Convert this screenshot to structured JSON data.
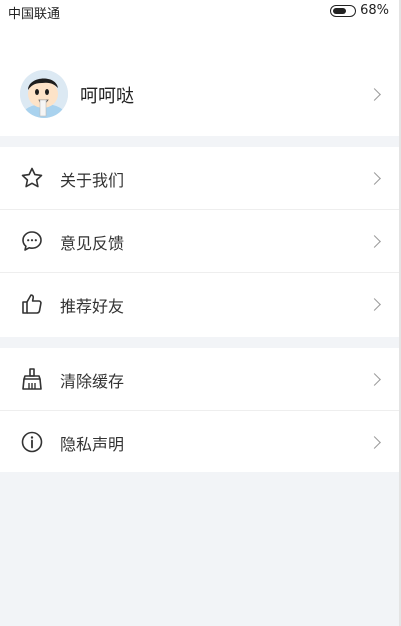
{
  "status_bar": {
    "carrier": "中国联通",
    "battery_percent_text": "68%",
    "battery_level": 0.68
  },
  "profile": {
    "name": "呵呵哒",
    "avatar_icon": "cartoon-avatar"
  },
  "menu_group_1": [
    {
      "label": "关于我们",
      "icon": "star-outline-icon"
    },
    {
      "label": "意见反馈",
      "icon": "chat-bubble-icon"
    },
    {
      "label": "推荐好友",
      "icon": "thumbs-up-icon"
    }
  ],
  "menu_group_2": [
    {
      "label": "清除缓存",
      "icon": "broom-icon"
    },
    {
      "label": "隐私声明",
      "icon": "info-circle-icon"
    }
  ],
  "colors": {
    "background": "#f2f4f7",
    "card": "#ffffff",
    "text": "#333333",
    "chevron": "#9a9a9a"
  }
}
